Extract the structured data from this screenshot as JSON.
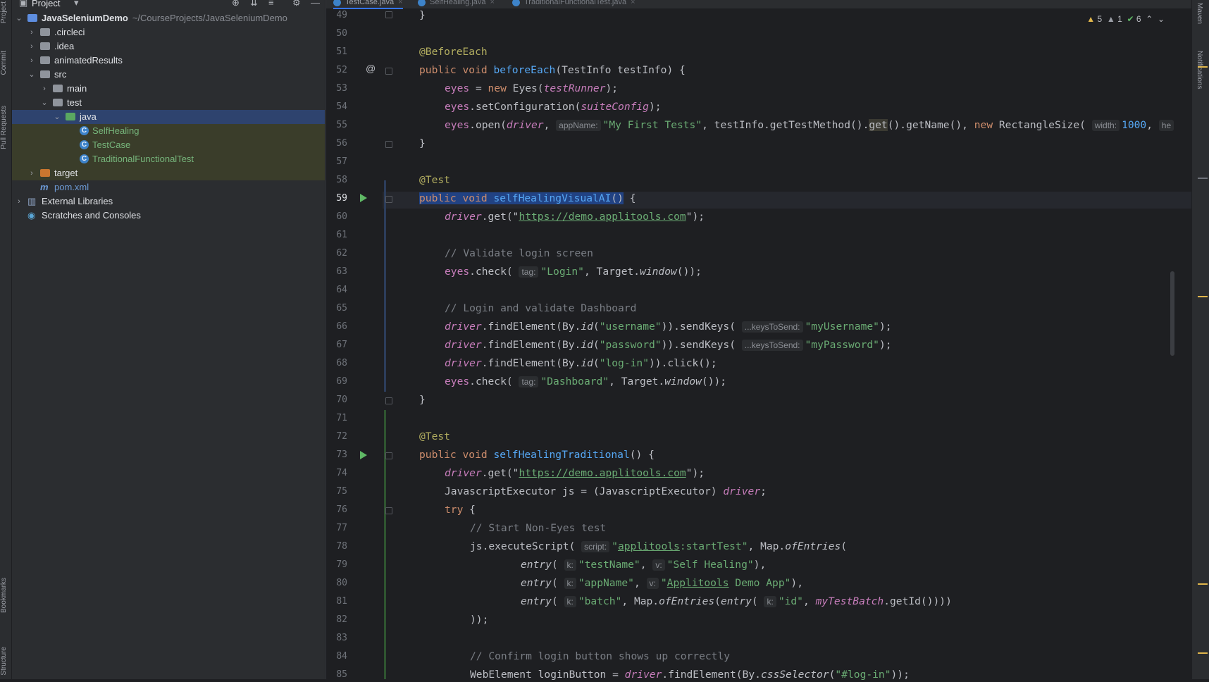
{
  "left_strip": {
    "project": "Project",
    "commit": "Commit",
    "pull_requests": "Pull Requests",
    "bookmarks": "Bookmarks",
    "structure": "Structure"
  },
  "right_strip": {
    "maven": "Maven",
    "notifications": "Notifications"
  },
  "project_panel": {
    "title": "Project",
    "tree": [
      {
        "label": "JavaSeleniumDemo",
        "path": "~/CourseProjects/JavaSeleniumDemo"
      },
      {
        "label": ".circleci"
      },
      {
        "label": ".idea"
      },
      {
        "label": "animatedResults"
      },
      {
        "label": "src"
      },
      {
        "label": "main"
      },
      {
        "label": "test"
      },
      {
        "label": "java"
      },
      {
        "label": "SelfHealing"
      },
      {
        "label": "TestCase"
      },
      {
        "label": "TraditionalFunctionalTest"
      },
      {
        "label": "target"
      },
      {
        "label": "pom.xml"
      },
      {
        "label": "External Libraries"
      },
      {
        "label": "Scratches and Consoles"
      }
    ]
  },
  "tabs": [
    {
      "label": "TestCase.java"
    },
    {
      "label": "SelfHealing.java"
    },
    {
      "label": "TraditionalFunctionalTest.java"
    }
  ],
  "inspections": {
    "warnings": "5",
    "weak_warnings": "1",
    "ok": "6"
  },
  "editor": {
    "line_numbers": [
      "49",
      "50",
      "51",
      "52",
      "53",
      "54",
      "55",
      "56",
      "57",
      "58",
      "59",
      "60",
      "61",
      "62",
      "63",
      "64",
      "65",
      "66",
      "67",
      "68",
      "69",
      "70",
      "71",
      "72",
      "73",
      "74",
      "75",
      "76",
      "77",
      "78",
      "79",
      "80",
      "81",
      "82",
      "83",
      "84",
      "85"
    ],
    "current_line": "59",
    "text": {
      "l49": "}",
      "l51": "@BeforeEach",
      "l52a": "public void ",
      "l52b": "beforeEach",
      "l52c": "(TestInfo testInfo) {",
      "l53a": "eyes",
      "l53b": " = ",
      "l53c": "new",
      "l53d": " Eyes(",
      "l53e": "testRunner",
      "l53f": ");",
      "l54a": "eyes",
      "l54b": ".setConfiguration(",
      "l54c": "suiteConfig",
      "l54d": ");",
      "l55a": "eyes",
      "l55b": ".open(",
      "l55c": "driver",
      "l55d": ", ",
      "l55h1": "appName:",
      "l55e": "\"My First Tests\"",
      "l55f": ", testInfo.getTestMethod().",
      "l55g": "get",
      "l55i": "().getName(), ",
      "l55j": "new",
      "l55k": " RectangleSize( ",
      "l55h2": "width:",
      "l55l": "1000",
      "l55m": ", ",
      "l55n": "he",
      "l56": "}",
      "l58": "@Test",
      "l59a": "public void ",
      "l59b": "selfHealingVisualAI",
      "l59c": "()",
      "l59d": " {",
      "l60a": "driver",
      "l60b": ".get(\"",
      "l60c": "https://demo.applitools.com",
      "l60d": "\");",
      "l62": "// Validate login screen",
      "l63a": "eyes",
      "l63b": ".check( ",
      "l63h": "tag:",
      "l63c": "\"Login\"",
      "l63d": ", Target.",
      "l63e": "window",
      "l63f": "());",
      "l65": "// Login and validate Dashboard",
      "l66a": "driver",
      "l66b": ".findElement(By.",
      "l66c": "id",
      "l66d": "(",
      "l66e": "\"username\"",
      "l66f": ")).sendKeys( ",
      "l66h": "...keysToSend:",
      "l66g": "\"myUsername\"",
      "l66i": ");",
      "l67a": "driver",
      "l67b": ".findElement(By.",
      "l67c": "id",
      "l67d": "(",
      "l67e": "\"password\"",
      "l67f": ")).sendKeys( ",
      "l67h": "...keysToSend:",
      "l67g": "\"myPassword\"",
      "l67i": ");",
      "l68a": "driver",
      "l68b": ".findElement(By.",
      "l68c": "id",
      "l68d": "(",
      "l68e": "\"log-in\"",
      "l68f": ")).click();",
      "l69a": "eyes",
      "l69b": ".check( ",
      "l69h": "tag:",
      "l69c": "\"Dashboard\"",
      "l69d": ", Target.",
      "l69e": "window",
      "l69f": "());",
      "l70": "}",
      "l72": "@Test",
      "l73a": "public void ",
      "l73b": "selfHealingTraditional",
      "l73c": "() {",
      "l74a": "driver",
      "l74b": ".get(\"",
      "l74c": "https://demo.applitools.com",
      "l74d": "\");",
      "l75a": "JavascriptExecutor js = (JavascriptExecutor) ",
      "l75b": "driver",
      "l75c": ";",
      "l76a": "try",
      "l76b": " {",
      "l77": "// Start Non-Eyes test",
      "l78a": "js.executeScript( ",
      "l78h": "script:",
      "l78b": "\"",
      "l78c": "applitools",
      "l78d": ":startTest\"",
      "l78e": ", Map.",
      "l78f": "ofEntries",
      "l78g": "(",
      "l79a": "entry",
      "l79b": "( ",
      "l79h1": "k:",
      "l79c": "\"testName\"",
      "l79d": ", ",
      "l79h2": "v:",
      "l79e": "\"Self Healing\"",
      "l79f": "),",
      "l80a": "entry",
      "l80b": "( ",
      "l80h1": "k:",
      "l80c": "\"appName\"",
      "l80d": ", ",
      "l80h2": "v:",
      "l80e1": "\"",
      "l80e2": "Applitools",
      "l80e3": " Demo App\"",
      "l80f": "),",
      "l81a": "entry",
      "l81b": "( ",
      "l81h1": "k:",
      "l81c": "\"batch\"",
      "l81d": ", Map.",
      "l81e": "ofEntries",
      "l81f": "(",
      "l81g": "entry",
      "l81i": "( ",
      "l81h2": "k:",
      "l81j": "\"id\"",
      "l81k": ", ",
      "l81l": "myTestBatch",
      "l81m": ".getId())))",
      "l82": "));",
      "l84": "// Confirm login button shows up correctly",
      "l85a": "WebElement loginButton = ",
      "l85b": "driver",
      "l85c": ".findElement(By.",
      "l85d": "cssSelector",
      "l85e": "(",
      "l85f": "\"#log-in\"",
      "l85g": "));"
    }
  }
}
